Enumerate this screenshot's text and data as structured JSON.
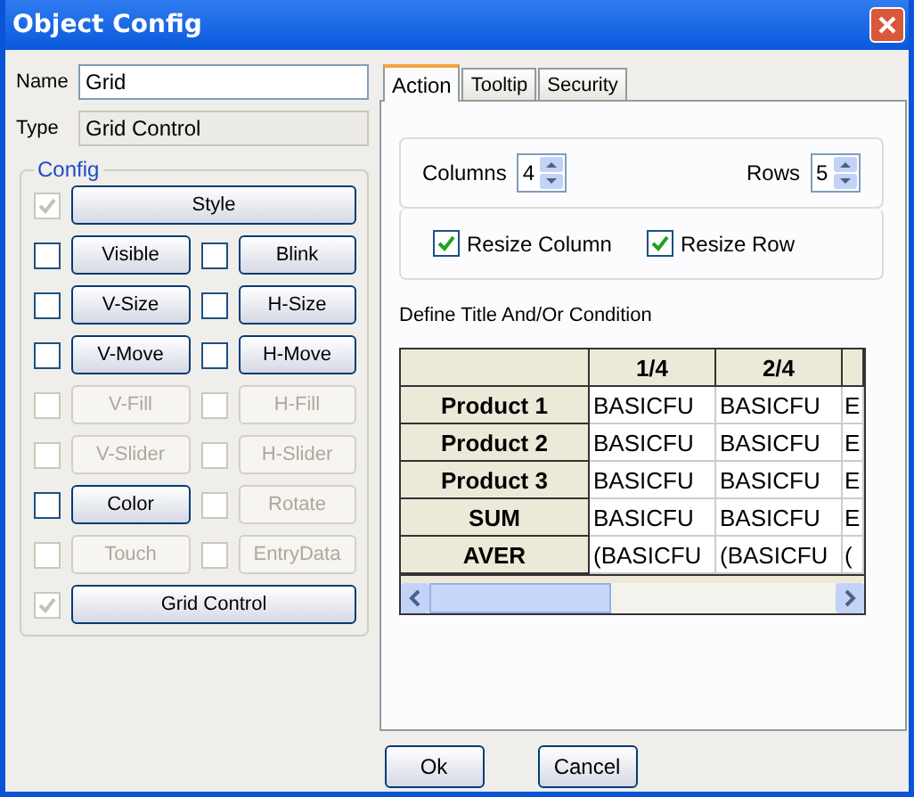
{
  "window": {
    "title": "Object Config"
  },
  "name_field": {
    "label": "Name",
    "value": "Grid"
  },
  "type_field": {
    "label": "Type",
    "value": "Grid Control"
  },
  "config": {
    "title": "Config",
    "rows": [
      [
        {
          "label": "Style",
          "checked": true,
          "disabled": true,
          "button_disabled": false
        }
      ],
      [
        {
          "label": "Visible",
          "checked": false,
          "disabled": false,
          "button_disabled": false
        },
        {
          "label": "Blink",
          "checked": false,
          "disabled": false,
          "button_disabled": false
        }
      ],
      [
        {
          "label": "V-Size",
          "checked": false,
          "disabled": false,
          "button_disabled": false
        },
        {
          "label": "H-Size",
          "checked": false,
          "disabled": false,
          "button_disabled": false
        }
      ],
      [
        {
          "label": "V-Move",
          "checked": false,
          "disabled": false,
          "button_disabled": false
        },
        {
          "label": "H-Move",
          "checked": false,
          "disabled": false,
          "button_disabled": false
        }
      ],
      [
        {
          "label": "V-Fill",
          "checked": false,
          "disabled": true,
          "button_disabled": true
        },
        {
          "label": "H-Fill",
          "checked": false,
          "disabled": true,
          "button_disabled": true
        }
      ],
      [
        {
          "label": "V-Slider",
          "checked": false,
          "disabled": true,
          "button_disabled": true
        },
        {
          "label": "H-Slider",
          "checked": false,
          "disabled": true,
          "button_disabled": true
        }
      ],
      [
        {
          "label": "Color",
          "checked": false,
          "disabled": false,
          "button_disabled": false
        },
        {
          "label": "Rotate",
          "checked": false,
          "disabled": true,
          "button_disabled": true
        }
      ],
      [
        {
          "label": "Touch",
          "checked": false,
          "disabled": true,
          "button_disabled": true
        },
        {
          "label": "EntryData",
          "checked": false,
          "disabled": true,
          "button_disabled": true
        }
      ],
      [
        {
          "label": "Grid Control",
          "checked": true,
          "disabled": true,
          "button_disabled": false
        }
      ]
    ]
  },
  "tabs": [
    {
      "label": "Action",
      "selected": true
    },
    {
      "label": "Tooltip",
      "selected": false
    },
    {
      "label": "Security",
      "selected": false
    }
  ],
  "columns": {
    "label": "Columns",
    "value": "4"
  },
  "rows": {
    "label": "Rows",
    "value": "5"
  },
  "resize": [
    {
      "label": "Resize Column",
      "checked": true
    },
    {
      "label": "Resize Row",
      "checked": true
    }
  ],
  "define_label": "Define Title And/Or Condition",
  "table": {
    "columns": [
      "",
      "1/4",
      "2/4",
      ""
    ],
    "rows": [
      {
        "cells": [
          "Product 1",
          "BASICFU",
          "BASICFU",
          "E"
        ]
      },
      {
        "cells": [
          "Product 2",
          "BASICFU",
          "BASICFU",
          "E"
        ]
      },
      {
        "cells": [
          "Product 3",
          "BASICFU",
          "BASICFU",
          "E"
        ]
      },
      {
        "cells": [
          "SUM",
          "BASICFU",
          "BASICFU",
          "E"
        ]
      },
      {
        "cells": [
          "AVER",
          "(BASICFU",
          "(BASICFU",
          "("
        ]
      }
    ]
  },
  "buttons": [
    "Ok",
    "Cancel"
  ]
}
